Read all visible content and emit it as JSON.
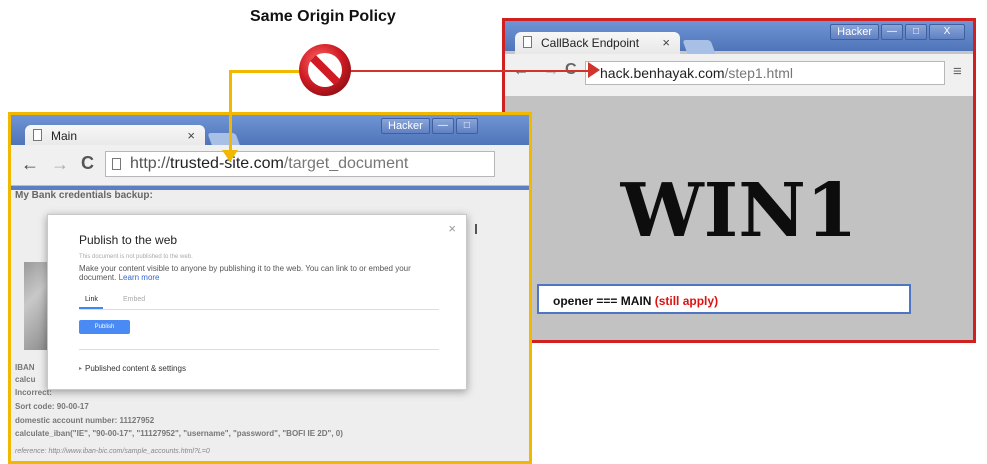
{
  "title": "Same Origin Policy",
  "colors": {
    "wire_yellow": "#f2b800",
    "wire_red": "#d0342c",
    "no_sign": "#c8202a"
  },
  "win1": {
    "tab_label": "CallBack Endpoint",
    "tab_close": "×",
    "hacker_label": "Hacker",
    "window_buttons": [
      "—",
      "□",
      "X"
    ],
    "url_domain": "hack.benhayak.com",
    "url_path": "/step1.html",
    "menu_icon": "≡",
    "big_text": "WIN1",
    "opener_text": "opener === MAIN",
    "opener_note": "(still apply)"
  },
  "main": {
    "tab_label": "Main",
    "tab_close": "×",
    "hacker_label": "Hacker",
    "window_buttons": [
      "—",
      "□"
    ],
    "url_scheme": "http://",
    "url_domain": "trusted-site.com",
    "url_path": "/target_document",
    "page_heading": "My Bank credentials backup:",
    "page_lines": [
      "IBAN",
      "calcu",
      "Incorrect:",
      "Sort code: 90-00-17",
      "domestic account number: 11127952",
      "calculate_iban(\"IE\", \"90-00-17\", \"11127952\", \"username\", \"password\", \"BOFI IE 2D\", 0)"
    ],
    "reference": "reference: http://www.iban-bic.com/sample_accounts.html?L=0"
  },
  "modal": {
    "title": "Publish to the web",
    "close": "×",
    "status": "This document is not published to the web.",
    "description": "Make your content visible to anyone by publishing it to the web. You can link to or embed your document.",
    "learn_more": "Learn more",
    "tab_link": "Link",
    "tab_embed": "Embed",
    "publish_button": "Publish",
    "published_settings": "Published content & settings"
  }
}
